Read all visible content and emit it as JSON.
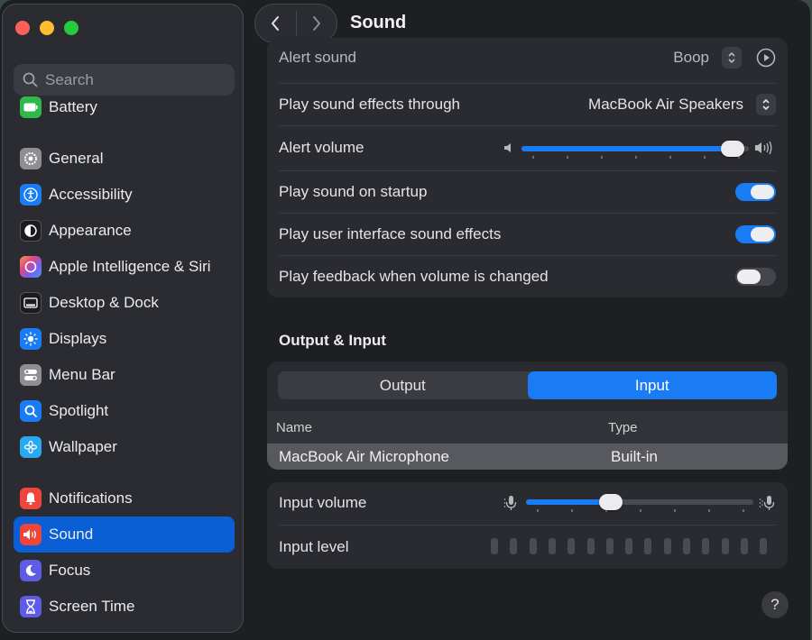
{
  "search": {
    "placeholder": "Search"
  },
  "sidebar": {
    "items": [
      {
        "label": "Battery",
        "icon": "battery-icon"
      },
      {
        "label": "General",
        "icon": "gear-icon"
      },
      {
        "label": "Accessibility",
        "icon": "accessibility-icon"
      },
      {
        "label": "Appearance",
        "icon": "appearance-icon"
      },
      {
        "label": "Apple Intelligence & Siri",
        "icon": "siri-icon"
      },
      {
        "label": "Desktop & Dock",
        "icon": "dock-icon"
      },
      {
        "label": "Displays",
        "icon": "sun-icon"
      },
      {
        "label": "Menu Bar",
        "icon": "menu-bar-icon"
      },
      {
        "label": "Spotlight",
        "icon": "magnifier-icon"
      },
      {
        "label": "Wallpaper",
        "icon": "flower-icon"
      },
      {
        "label": "Notifications",
        "icon": "bell-icon"
      },
      {
        "label": "Sound",
        "icon": "speaker-icon",
        "selected": true
      },
      {
        "label": "Focus",
        "icon": "moon-icon"
      },
      {
        "label": "Screen Time",
        "icon": "hourglass-icon"
      }
    ]
  },
  "header": {
    "title": "Sound"
  },
  "effects": {
    "alert_sound_label": "Alert sound",
    "alert_sound_value": "Boop",
    "play_through_label": "Play sound effects through",
    "play_through_value": "MacBook Air Speakers",
    "alert_volume_label": "Alert volume",
    "alert_volume_level": 0.98,
    "startup_label": "Play sound on startup",
    "startup_on": true,
    "ui_effects_label": "Play user interface sound effects",
    "ui_effects_on": true,
    "feedback_label": "Play feedback when volume is changed",
    "feedback_on": false
  },
  "output_input": {
    "section_title": "Output & Input",
    "tabs": [
      "Output",
      "Input"
    ],
    "selected_tab": "Input",
    "columns": [
      "Name",
      "Type"
    ],
    "devices": [
      {
        "name": "MacBook Air Microphone",
        "type": "Built-in"
      }
    ],
    "input_volume_label": "Input volume",
    "input_volume_level": 0.36,
    "input_level_label": "Input level"
  },
  "help": "?",
  "colors": {
    "accent": "#1a7cf5",
    "selected_sidebar": "#0a5fd6"
  }
}
